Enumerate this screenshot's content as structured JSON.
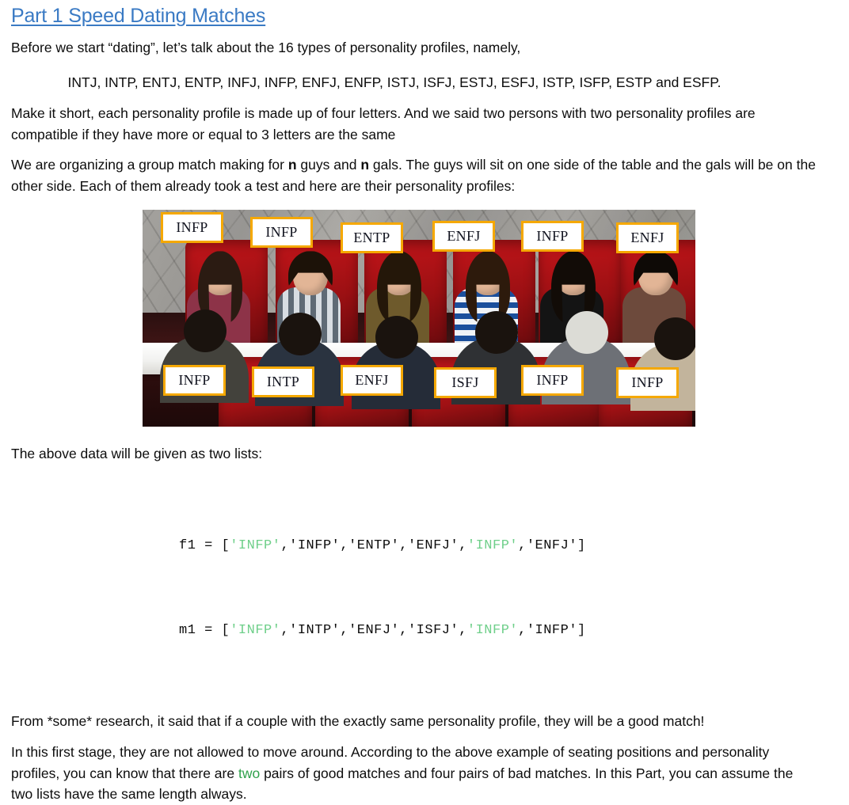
{
  "title": "Part 1 Speed Dating Matches",
  "paragraphs": {
    "intro": "Before we start “dating”, let’s talk about the 16 types of personality profiles, namely,",
    "types_list": "INTJ, INTP, ENTJ, ENTP, INFJ, INFP, ENFJ, ENFP, ISTJ, ISFJ, ESTJ, ESFJ, ISTP, ISFP, ESTP and ESFP.",
    "short_desc_line1": "Make it short, each personality profile is made up of four letters. And we said two persons with two personality profiles",
    "short_desc_line2": "are compatible if they have more or equal to 3 letters are the same",
    "organizing_pre": "We are organizing a group match making for ",
    "organizing_n1": "n",
    "organizing_mid": " guys and ",
    "organizing_n2": "n",
    "organizing_post": " gals. The guys will sit on one side of the table and the gals will be on the other side. Each of them already took a test and here are their personality profiles:",
    "two_lists_caption": "The above data will be given as two lists:",
    "research": "From *some* research, it said that if a couple with the exactly same personality profile, they will be a good match!",
    "stage_pre": "In this first stage, they are not allowed to move around. According to the above example of seating positions and personality profiles, you can know that there are ",
    "stage_green": "two",
    "stage_post": " pairs of good matches and four pairs of bad matches. In this Part, you can assume the two lists have the same length always."
  },
  "photo": {
    "alt": "speed dating event photo: six women seated in red chairs facing six men across a long white table",
    "top_labels": [
      "INFP",
      "INFP",
      "ENTP",
      "ENFJ",
      "INFP",
      "ENFJ"
    ],
    "bottom_labels": [
      "INFP",
      "INTP",
      "ENFJ",
      "ISFJ",
      "INFP",
      "INFP"
    ]
  },
  "code": {
    "f1": {
      "name": "f1",
      "assign": " = [",
      "close": "]",
      "items": [
        {
          "text": "'INFP'",
          "green": true
        },
        {
          "text": "'INFP'",
          "green": false
        },
        {
          "text": "'ENTP'",
          "green": false
        },
        {
          "text": "'ENFJ'",
          "green": false
        },
        {
          "text": "'INFP'",
          "green": true
        },
        {
          "text": "'ENFJ'",
          "green": false
        }
      ]
    },
    "m1": {
      "name": "m1",
      "assign": " = [",
      "close": "]",
      "items": [
        {
          "text": "'INFP'",
          "green": true
        },
        {
          "text": "'INTP'",
          "green": false
        },
        {
          "text": "'ENFJ'",
          "green": false
        },
        {
          "text": "'ISFJ'",
          "green": false
        },
        {
          "text": "'INFP'",
          "green": true
        },
        {
          "text": "'INFP'",
          "green": false
        }
      ]
    }
  },
  "colors": {
    "title_blue": "#3a7ac4",
    "label_border": "#f5a800",
    "highlight_green": "#2fa14b",
    "code_string_green": "#6fcf8a",
    "text": "#0d0d0d"
  }
}
